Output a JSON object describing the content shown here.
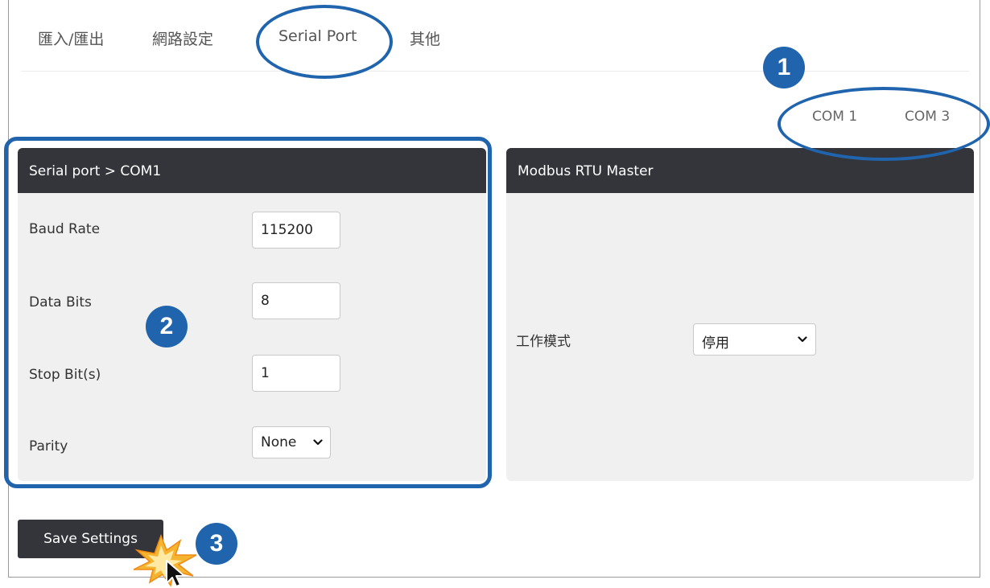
{
  "tabs": [
    {
      "label": "匯入/匯出"
    },
    {
      "label": "網路設定"
    },
    {
      "label": "Serial Port",
      "active": true
    },
    {
      "label": "其他"
    }
  ],
  "com_ports": [
    "COM 1",
    "COM 3"
  ],
  "serial_panel": {
    "title": "Serial port > COM1",
    "fields": [
      {
        "label": "Baud Rate",
        "value": "115200"
      },
      {
        "label": "Data Bits",
        "value": "8"
      },
      {
        "label": "Stop Bit(s)",
        "value": "1"
      },
      {
        "label": "Parity",
        "value": "None"
      }
    ]
  },
  "modbus_panel": {
    "title": "Modbus RTU Master",
    "mode_label": "工作模式",
    "mode_value": "停用"
  },
  "save_button": {
    "label": "Save Settings"
  },
  "annotations": {
    "step1": "1",
    "step2": "2",
    "step3": "3",
    "color": "#1f64ad"
  },
  "icons": {
    "dropdown": "chevron-down-icon",
    "cursor": "mouse-pointer-icon",
    "click_burst": "click-burst-icon"
  }
}
